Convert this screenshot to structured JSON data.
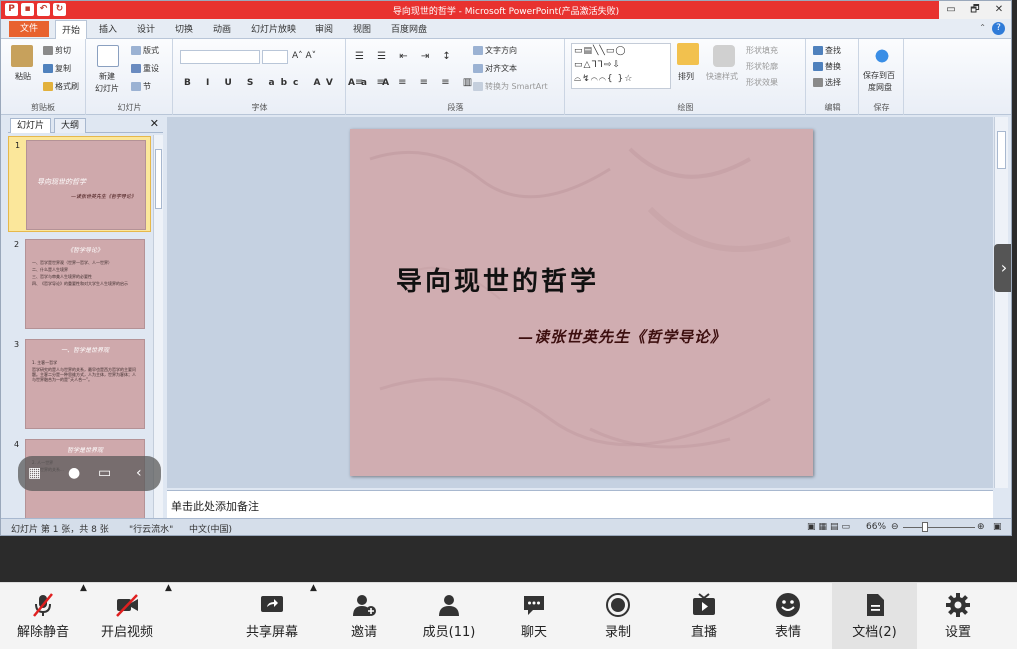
{
  "window": {
    "title": "导向现世的哲学 - Microsoft PowerPoint(产品激活失败)",
    "controls": [
      "▭",
      "🗗",
      "✕"
    ]
  },
  "tabs": {
    "file": "文件",
    "start": "开始",
    "insert": "插入",
    "design": "设计",
    "transition": "切换",
    "animation": "动画",
    "slideshow": "幻灯片放映",
    "review": "审阅",
    "view": "视图",
    "baidu": "百度网盘"
  },
  "ribbon": {
    "clipboard": {
      "paste": "粘贴",
      "cut": "剪切",
      "copy": "复制",
      "format": "格式刷",
      "label": "剪贴板"
    },
    "slides": {
      "new": "新建",
      "new2": "幻灯片",
      "layout": "版式",
      "reset": "重设",
      "section": "节",
      "label": "幻灯片"
    },
    "font": {
      "label": "字体"
    },
    "paragraph": {
      "direction": "文字方向",
      "align": "对齐文本",
      "smartart": "转换为 SmartArt",
      "label": "段落"
    },
    "drawing": {
      "arrange": "排列",
      "quickstyle": "快速样式",
      "fill": "形状填充",
      "outline": "形状轮廓",
      "effect": "形状效果",
      "label": "绘图"
    },
    "edit": {
      "find": "查找",
      "replace": "替换",
      "select": "选择",
      "label": "编辑"
    },
    "save": {
      "baidu": "保存到百",
      "baidu2": "度网盘",
      "label": "保存"
    }
  },
  "pane": {
    "tab_slides": "幻灯片",
    "tab_outline": "大纲",
    "close": "✕",
    "thumbs": [
      {
        "num": "1",
        "title": "导向现世的哲学",
        "sub": "—读张世英先生《哲学导论》"
      },
      {
        "num": "2",
        "title": "《哲学导论》",
        "lines": [
          "一、哲学是世界观（世界一哲学、人一世界）",
          "二、什么是人生境界",
          "三、哲学与审美人生境界的必要性",
          "四、《哲学导论》的重要性和对大学生人生境界的启示"
        ]
      },
      {
        "num": "3",
        "title": "一、哲学是世界观",
        "lines": [
          "1. 主客一哲学",
          "哲学研究的是人与世界的关系，最早也是西方哲学的主要问题。主客二分是一种思维方式，人为主体，世界为客体；人与世界融合为一的是“天人合一”。"
        ]
      },
      {
        "num": "4",
        "title": "哲学是世界观",
        "lines": [
          "2. 人一世界",
          "人与世界的关系..."
        ]
      }
    ]
  },
  "slide": {
    "title": "导向现世的哲学",
    "subtitle": "—读张世英先生《哲学导论》"
  },
  "notes": {
    "placeholder": "单击此处添加备注"
  },
  "status": {
    "slide_info": "幻灯片 第 1 张，共 8 张",
    "theme": "\"行云流水\"",
    "lang": "中文(中国)",
    "zoom": "66%"
  },
  "meeting_bar": {
    "mute": "解除静音",
    "video": "开启视频",
    "share": "共享屏幕",
    "invite": "邀请",
    "members": "成员(11)",
    "chat": "聊天",
    "record": "录制",
    "live": "直播",
    "emoji": "表情",
    "docs": "文档(2)",
    "settings": "设置"
  }
}
